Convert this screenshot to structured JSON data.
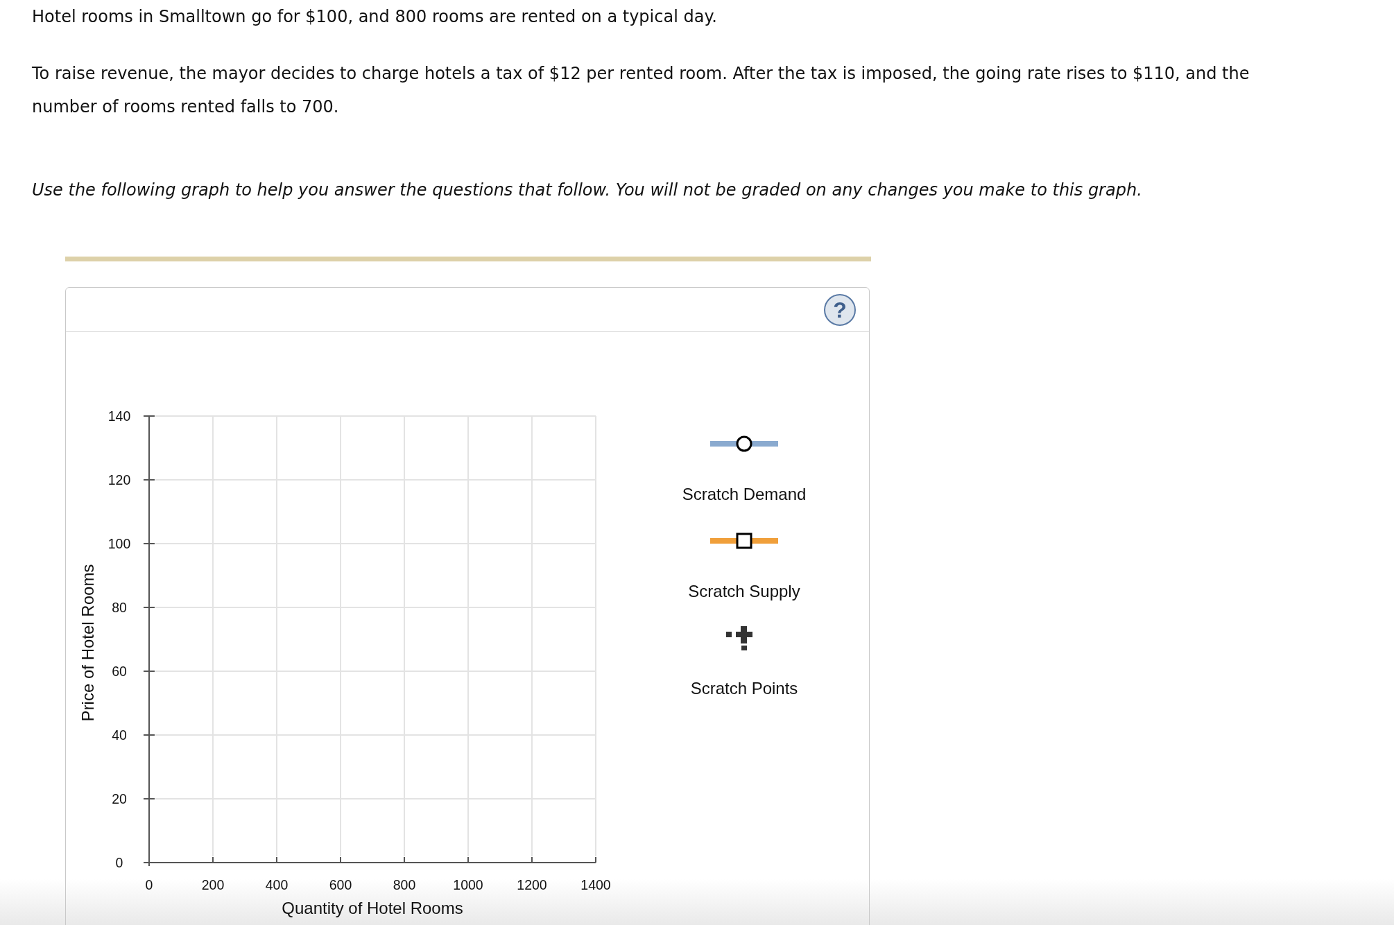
{
  "question": {
    "paragraphs": [
      "Hotel rooms in Smalltown go for $100, and 800 rooms are rented on a typical day.",
      "To raise revenue, the mayor decides to charge hotels a tax of $12 per rented room. After the tax is imposed, the going rate rises to $110, and the number of rooms rented falls to 700."
    ],
    "instruction": "Use the following graph to help you answer the questions that follow. You will not be graded on any changes you make to this graph."
  },
  "graph_panel": {
    "help_button": "?",
    "chart_data": [
      {
        "type": "line",
        "xlabel": "Quantity of Hotel Rooms",
        "ylabel": "Price of Hotel Rooms",
        "xlim": [
          0,
          1400
        ],
        "ylim": [
          0,
          140
        ],
        "xticks": [
          0,
          200,
          400,
          600,
          800,
          1000,
          1200,
          1400
        ],
        "yticks": [
          0,
          20,
          40,
          60,
          80,
          100,
          120,
          140
        ],
        "grid": true
      }
    ],
    "tools": [
      {
        "kind": "demand",
        "label": "Scratch Demand",
        "color": "#8aaacf"
      },
      {
        "kind": "supply",
        "label": "Scratch Supply",
        "color": "#f09f3a"
      },
      {
        "kind": "points",
        "label": "Scratch Points",
        "color": "#333333"
      }
    ]
  }
}
